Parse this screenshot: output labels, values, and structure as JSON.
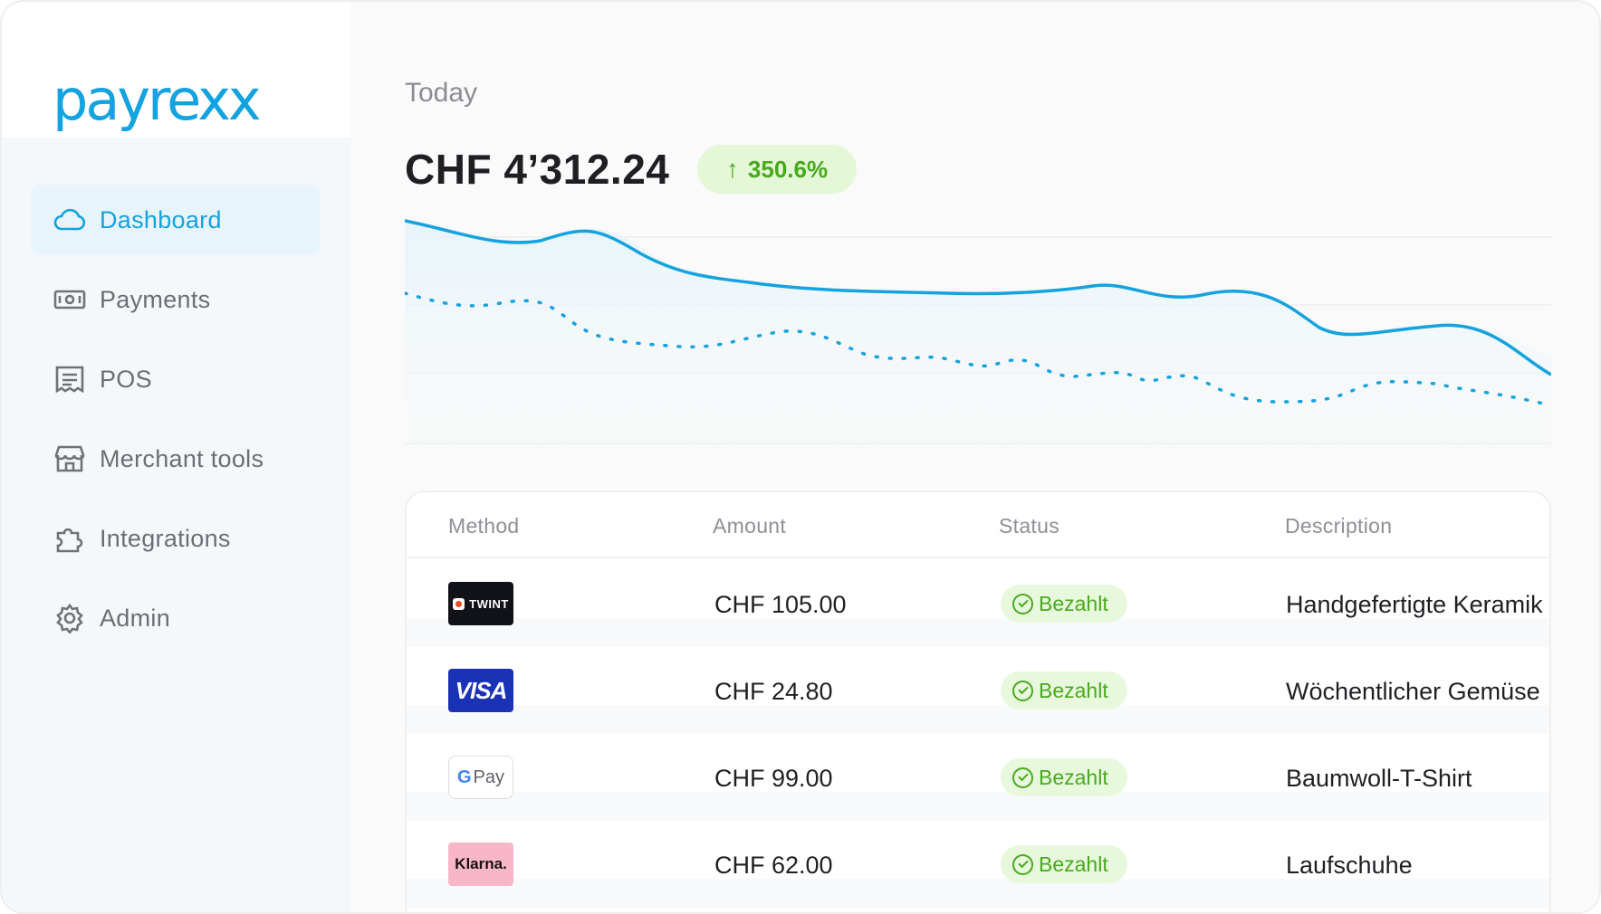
{
  "brand": {
    "name": "payrexx",
    "accent": "#14a3de"
  },
  "sidebar": {
    "items": [
      {
        "label": "Dashboard",
        "icon": "cloud-icon",
        "active": true
      },
      {
        "label": "Payments",
        "icon": "banknote-icon",
        "active": false
      },
      {
        "label": "POS",
        "icon": "receipt-icon",
        "active": false
      },
      {
        "label": "Merchant tools",
        "icon": "store-icon",
        "active": false
      },
      {
        "label": "Integrations",
        "icon": "puzzle-icon",
        "active": false
      },
      {
        "label": "Admin",
        "icon": "gear-icon",
        "active": false
      }
    ]
  },
  "summary": {
    "period": "Today",
    "total": "CHF 4’312.24",
    "delta": "350.6%",
    "delta_direction": "up"
  },
  "table": {
    "headers": {
      "method": "Method",
      "amount": "Amount",
      "status": "Status",
      "description": "Description"
    },
    "rows": [
      {
        "method": "TWINT",
        "amount": "CHF 105.00",
        "status": "Bezahlt",
        "description": "Handgefertigte Keramik"
      },
      {
        "method": "VISA",
        "amount": "CHF 24.80",
        "status": "Bezahlt",
        "description": "Wöchentlicher Gemüse"
      },
      {
        "method": "Pay",
        "amount": "CHF 99.00",
        "status": "Bezahlt",
        "description": "Baumwoll-T-Shirt"
      },
      {
        "method": "Klarna.",
        "amount": "CHF 62.00",
        "status": "Bezahlt",
        "description": "Laufschuhe"
      }
    ]
  },
  "colors": {
    "success": "#4aa91f",
    "success_bg": "#e7f8dc",
    "chart_line": "#14a3de"
  }
}
